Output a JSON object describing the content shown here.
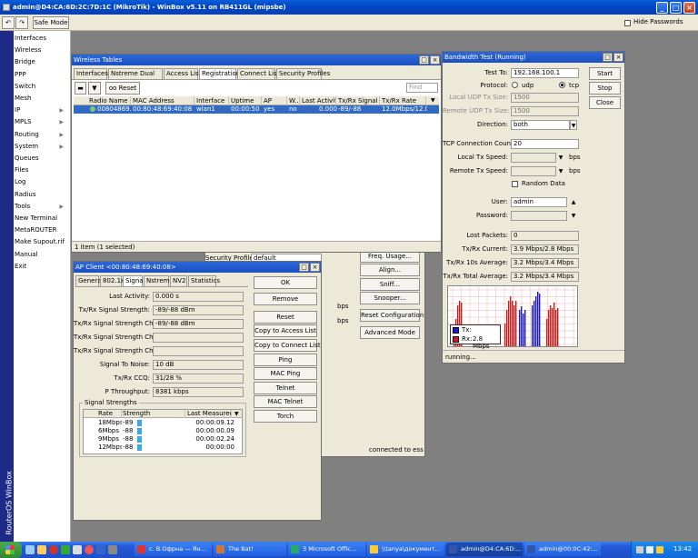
{
  "window": {
    "title": "admin@D4:CA:6D:2C:7D:1C (MikroTik) - WinBox v5.11 on RB411GL (mipsbe)",
    "safe_mode": "Safe Mode",
    "hide_passwords": "Hide Passwords"
  },
  "sidebar": {
    "brand": "RouterOS WinBox",
    "items": [
      {
        "label": "Interfaces",
        "arrow": false
      },
      {
        "label": "Wireless",
        "arrow": false
      },
      {
        "label": "Bridge",
        "arrow": false
      },
      {
        "label": "PPP",
        "arrow": false
      },
      {
        "label": "Switch",
        "arrow": false
      },
      {
        "label": "Mesh",
        "arrow": false
      },
      {
        "label": "IP",
        "arrow": true
      },
      {
        "label": "MPLS",
        "arrow": true
      },
      {
        "label": "Routing",
        "arrow": true
      },
      {
        "label": "System",
        "arrow": true
      },
      {
        "label": "Queues",
        "arrow": false
      },
      {
        "label": "Files",
        "arrow": false
      },
      {
        "label": "Log",
        "arrow": false
      },
      {
        "label": "Radius",
        "arrow": false
      },
      {
        "label": "Tools",
        "arrow": true
      },
      {
        "label": "New Terminal",
        "arrow": false
      },
      {
        "label": "MetaROUTER",
        "arrow": false
      },
      {
        "label": "Make Supout.rif",
        "arrow": false
      },
      {
        "label": "Manual",
        "arrow": false
      },
      {
        "label": "Exit",
        "arrow": false
      }
    ]
  },
  "wireless": {
    "title": "Wireless Tables",
    "tabs": [
      "Interfaces",
      "Nstreme Dual",
      "Access List",
      "Registration",
      "Connect List",
      "Security Profiles"
    ],
    "active_tab": "Registration",
    "reset": "Reset",
    "find": "Find",
    "columns": [
      "Radio Name",
      "MAC Address",
      "Interface",
      "Uptime",
      "AP",
      "W...",
      "Last Activit...",
      "Tx/Rx Signal ...",
      "Tx/Rx Rate"
    ],
    "rows": [
      [
        "00804869...",
        "00:80:48:69:40:08",
        "wlan1",
        "00:00:50",
        "yes",
        "no",
        "0.000",
        "-89/-88",
        "12.0Mbps/12.0..."
      ]
    ],
    "status": "1 item (1 selected)"
  },
  "behind": {
    "security_profile_label": "Security Profile:",
    "security_profile_value": "default",
    "buttons": [
      "Freq. Usage...",
      "Align...",
      "Sniff...",
      "Snooper...",
      "Reset Configuration",
      "Advanced Mode"
    ],
    "bps": "bps",
    "status": "connected to ess"
  },
  "ap_client": {
    "title": "AP Client <00:80:48:69:40:08>",
    "tabs": [
      "General",
      "802.1x",
      "Signal",
      "Nstreme",
      "NV2",
      "Statistics"
    ],
    "active_tab": "Signal",
    "fields": [
      {
        "label": "Last Activity:",
        "value": "0.000 s"
      },
      {
        "label": "Tx/Rx Signal Strength:",
        "value": "-89/-88 dBm"
      },
      {
        "label": "Tx/Rx Signal Strength Ch0:",
        "value": "-89/-88 dBm"
      },
      {
        "label": "Tx/Rx Signal Strength Ch1:",
        "value": ""
      },
      {
        "label": "Tx/Rx Signal Strength Ch2:",
        "value": ""
      },
      {
        "label": "Signal To Noise:",
        "value": "10 dB"
      },
      {
        "label": "Tx/Rx CCQ:",
        "value": "31/28 %"
      },
      {
        "label": "P Throughput:",
        "value": "8381 kbps"
      }
    ],
    "strengths_group": "Signal Strengths",
    "strength_columns": [
      "Rate",
      "Strength",
      "Last Measured"
    ],
    "strengths": [
      {
        "rate": "18Mbps",
        "strength": "-89",
        "last": "00:00:09.12"
      },
      {
        "rate": "6Mbps",
        "strength": "-88",
        "last": "00:00:00.09"
      },
      {
        "rate": "9Mbps",
        "strength": "-88",
        "last": "00:00:02.24"
      },
      {
        "rate": "12Mbps",
        "strength": "-88",
        "last": "00:00:00"
      }
    ],
    "buttons": [
      "OK",
      "Remove",
      "Reset",
      "Copy to Access List",
      "Copy to Connect List",
      "Ping",
      "MAC Ping",
      "Telnet",
      "MAC Telnet",
      "Torch"
    ]
  },
  "bandwidth": {
    "title": "Bandwidth Test (Running)",
    "test_to_label": "Test To:",
    "test_to": "192.168.100.1",
    "protocol_label": "Protocol:",
    "udp": "udp",
    "tcp": "tcp",
    "local_udp_label": "Local UDP Tx Size:",
    "local_udp": "1500",
    "remote_udp_label": "Remote UDP Tx Size:",
    "remote_udp": "1500",
    "direction_label": "Direction:",
    "direction": "both",
    "tcp_count_label": "TCP Connection Count:",
    "tcp_count": "20",
    "local_speed_label": "Local Tx Speed:",
    "remote_speed_label": "Remote Tx Speed:",
    "bps": "bps",
    "random_data": "Random Data",
    "user_label": "User:",
    "user": "admin",
    "password_label": "Password:",
    "lost_label": "Lost Packets:",
    "lost": "0",
    "current_label": "Tx/Rx Current:",
    "current": "3.9 Mbps/2.8 Mbps",
    "avg10_label": "Tx/Rx 10s Average:",
    "avg10": "3.2 Mbps/3.4 Mbps",
    "total_label": "Tx/Rx Total Average:",
    "total": "3.2 Mbps/3.4 Mbps",
    "buttons": [
      "Start",
      "Stop",
      "Close"
    ],
    "legend_tx": "Tx:",
    "legend_rx": "Rx:",
    "legend_rx_value": "2.8 Mbps",
    "status": "running...",
    "tx_color": "#1a1ad0",
    "rx_color": "#d01a1a"
  },
  "taskbar": {
    "tasks": [
      {
        "label": "c. B.Офрна — Ян...",
        "color": "#d33"
      },
      {
        "label": "The Bat!",
        "color": "#c73"
      },
      {
        "label": "3 Microsoft Offic...",
        "color": "#2a6"
      },
      {
        "label": "\\\\tanya\\документ...",
        "color": "#fc3"
      },
      {
        "label": "admin@D4:CA:6D:...",
        "color": "#35a"
      },
      {
        "label": "admin@00:0C:42:...",
        "color": "#35a"
      }
    ],
    "clock": "13:42"
  }
}
